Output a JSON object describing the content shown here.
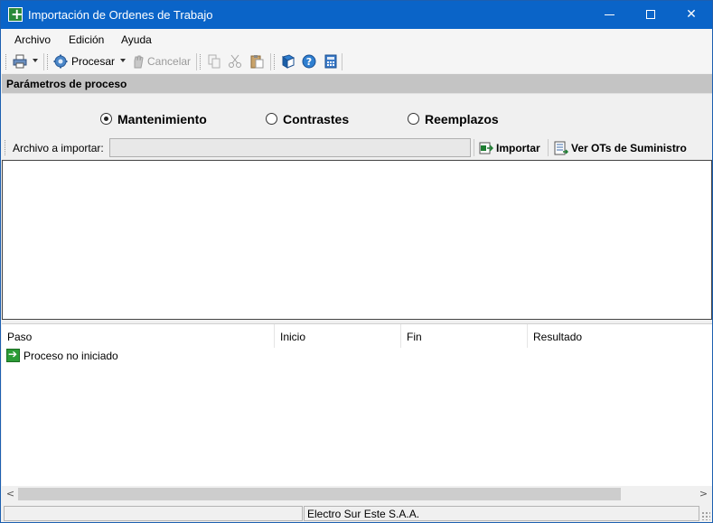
{
  "window": {
    "title": "Importación de Ordenes de Trabajo",
    "controls": {
      "minimize": "minimize",
      "maximize": "maximize",
      "close": "✕"
    }
  },
  "menu": [
    "Archivo",
    "Edición",
    "Ayuda"
  ],
  "toolbar": {
    "procesar": "Procesar",
    "cancelar": "Cancelar",
    "icons": [
      "printer-icon",
      "gear-icon",
      "hand-icon",
      "copy-icon",
      "cut-icon",
      "paste-icon",
      "book-help-icon",
      "help-icon",
      "calculator-icon"
    ]
  },
  "section": {
    "title": "Parámetros de proceso"
  },
  "process_types": {
    "options": [
      "Mantenimiento",
      "Contrastes",
      "Reemplazos"
    ],
    "selected": "Mantenimiento"
  },
  "import": {
    "label": "Archivo a importar:",
    "file_value": "",
    "import_button": "Importar",
    "view_button": "Ver OTs de Suministro"
  },
  "list": {
    "columns": [
      "Paso",
      "Inicio",
      "Fin",
      "Resultado"
    ],
    "rows": [
      {
        "paso": "Proceso no iniciado",
        "inicio": "",
        "fin": "",
        "resultado": ""
      }
    ]
  },
  "scrollbar": {
    "left": "<",
    "right": ">"
  },
  "status": {
    "left": "",
    "company": "Electro Sur Este S.A.A."
  }
}
